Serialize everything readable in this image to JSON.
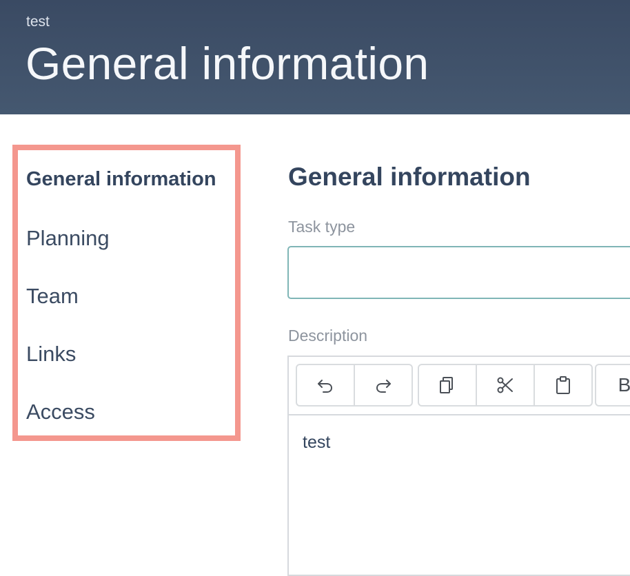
{
  "header": {
    "breadcrumb": "test",
    "title": "General information"
  },
  "sidebar": {
    "items": [
      {
        "label": "General information",
        "active": true
      },
      {
        "label": "Planning",
        "active": false
      },
      {
        "label": "Team",
        "active": false
      },
      {
        "label": "Links",
        "active": false
      },
      {
        "label": "Access",
        "active": false
      }
    ]
  },
  "main": {
    "section_title": "General information",
    "task_type": {
      "label": "Task type",
      "value": ""
    },
    "description": {
      "label": "Description",
      "content": "test",
      "toolbar": {
        "history_group": [
          "undo-icon",
          "redo-icon"
        ],
        "clipboard_group": [
          "copy-icon",
          "cut-icon",
          "paste-icon"
        ],
        "format_group": [
          {
            "icon": "bold-icon",
            "glyph": "B"
          }
        ]
      }
    }
  },
  "colors": {
    "header_bg": "#3d4e67",
    "highlight_border": "#f4978e",
    "input_focus_border": "#7fb5b6",
    "text_primary": "#34455e",
    "label_muted": "#8d949e"
  }
}
